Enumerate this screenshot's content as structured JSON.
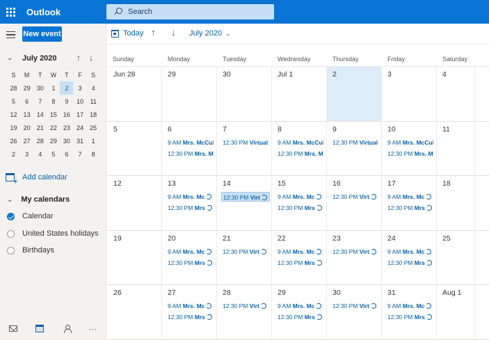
{
  "app": {
    "title": "Outlook"
  },
  "search": {
    "placeholder": "Search"
  },
  "leftpane": {
    "new_event_label": "New event",
    "mini_month_title": "July 2020",
    "dow": [
      "S",
      "M",
      "T",
      "W",
      "T",
      "F",
      "S"
    ],
    "mini_days": [
      "28",
      "29",
      "30",
      "1",
      "2",
      "3",
      "4",
      "5",
      "6",
      "7",
      "8",
      "9",
      "10",
      "11",
      "12",
      "13",
      "14",
      "15",
      "16",
      "17",
      "18",
      "19",
      "20",
      "21",
      "22",
      "23",
      "24",
      "25",
      "26",
      "27",
      "28",
      "29",
      "30",
      "31",
      "1",
      "2",
      "3",
      "4",
      "5",
      "6",
      "7",
      "8"
    ],
    "mini_selected_index": 4,
    "add_calendar_label": "Add calendar",
    "my_calendars_label": "My calendars",
    "calendars": [
      {
        "label": "Calendar",
        "checked": true
      },
      {
        "label": "United States holidays",
        "checked": false
      },
      {
        "label": "Birthdays",
        "checked": false
      }
    ],
    "bottom_icons": [
      "mail-icon",
      "calendar-icon",
      "people-icon",
      "more-icon"
    ]
  },
  "commandbar": {
    "today_label": "Today",
    "month_label": "July 2020"
  },
  "month_view": {
    "weekday_headers": [
      "Sunday",
      "Monday",
      "Tuesday",
      "Wednesday",
      "Thursday",
      "Friday",
      "Saturday"
    ],
    "weeks": [
      [
        {
          "label": "Jun 28",
          "events": []
        },
        {
          "label": "29",
          "events": []
        },
        {
          "label": "30",
          "events": []
        },
        {
          "label": "Jul 1",
          "events": []
        },
        {
          "label": "2",
          "today": true,
          "events": []
        },
        {
          "label": "3",
          "events": []
        },
        {
          "label": "4",
          "events": []
        }
      ],
      [
        {
          "label": "5",
          "events": []
        },
        {
          "label": "6",
          "events": [
            {
              "time": "9 AM",
              "title": "Mrs. McCul",
              "recurring": false
            },
            {
              "time": "12:30 PM",
              "title": "Mrs. Mc",
              "recurring": false
            }
          ]
        },
        {
          "label": "7",
          "events": [
            {
              "time": "12:30 PM",
              "title": "Virtual",
              "recurring": false
            }
          ]
        },
        {
          "label": "8",
          "events": [
            {
              "time": "9 AM",
              "title": "Mrs. McCul",
              "recurring": false
            },
            {
              "time": "12:30 PM",
              "title": "Mrs. Mc",
              "recurring": false
            }
          ]
        },
        {
          "label": "9",
          "events": [
            {
              "time": "12:30 PM",
              "title": "Virtual",
              "recurring": false
            }
          ]
        },
        {
          "label": "10",
          "events": [
            {
              "time": "9 AM",
              "title": "Mrs. McCul",
              "recurring": false
            },
            {
              "time": "12:30 PM",
              "title": "Mrs. Mc",
              "recurring": false
            }
          ]
        },
        {
          "label": "11",
          "events": []
        }
      ],
      [
        {
          "label": "12",
          "events": []
        },
        {
          "label": "13",
          "events": [
            {
              "time": "9 AM",
              "title": "Mrs. Mc",
              "recurring": true
            },
            {
              "time": "12:30 PM",
              "title": "Mrs",
              "recurring": true
            }
          ]
        },
        {
          "label": "14",
          "events": [
            {
              "time": "12:30 PM",
              "title": "Virt",
              "recurring": true,
              "selected": true
            }
          ]
        },
        {
          "label": "15",
          "events": [
            {
              "time": "9 AM",
              "title": "Mrs. Mc",
              "recurring": true
            },
            {
              "time": "12:30 PM",
              "title": "Mrs",
              "recurring": true
            }
          ]
        },
        {
          "label": "16",
          "events": [
            {
              "time": "12:30 PM",
              "title": "Virt",
              "recurring": true
            }
          ]
        },
        {
          "label": "17",
          "events": [
            {
              "time": "9 AM",
              "title": "Mrs. Mc",
              "recurring": true
            },
            {
              "time": "12:30 PM",
              "title": "Mrs",
              "recurring": true
            }
          ]
        },
        {
          "label": "18",
          "events": []
        }
      ],
      [
        {
          "label": "19",
          "events": []
        },
        {
          "label": "20",
          "events": [
            {
              "time": "9 AM",
              "title": "Mrs. Mc",
              "recurring": true
            },
            {
              "time": "12:30 PM",
              "title": "Mrs",
              "recurring": true
            }
          ]
        },
        {
          "label": "21",
          "events": [
            {
              "time": "12:30 PM",
              "title": "Virt",
              "recurring": true
            }
          ]
        },
        {
          "label": "22",
          "events": [
            {
              "time": "9 AM",
              "title": "Mrs. Mc",
              "recurring": true
            },
            {
              "time": "12:30 PM",
              "title": "Mrs",
              "recurring": true
            }
          ]
        },
        {
          "label": "23",
          "events": [
            {
              "time": "12:30 PM",
              "title": "Virt",
              "recurring": true
            }
          ]
        },
        {
          "label": "24",
          "events": [
            {
              "time": "9 AM",
              "title": "Mrs. Mc",
              "recurring": true
            },
            {
              "time": "12:30 PM",
              "title": "Mrs",
              "recurring": true
            }
          ]
        },
        {
          "label": "25",
          "events": []
        }
      ],
      [
        {
          "label": "26",
          "events": []
        },
        {
          "label": "27",
          "events": [
            {
              "time": "9 AM",
              "title": "Mrs. Mc",
              "recurring": true
            },
            {
              "time": "12:30 PM",
              "title": "Mrs",
              "recurring": true
            }
          ]
        },
        {
          "label": "28",
          "events": [
            {
              "time": "12:30 PM",
              "title": "Virt",
              "recurring": true
            }
          ]
        },
        {
          "label": "29",
          "events": [
            {
              "time": "9 AM",
              "title": "Mrs. Mc",
              "recurring": true
            },
            {
              "time": "12:30 PM",
              "title": "Mrs",
              "recurring": true
            }
          ]
        },
        {
          "label": "30",
          "events": [
            {
              "time": "12:30 PM",
              "title": "Virt",
              "recurring": true
            }
          ]
        },
        {
          "label": "31",
          "events": [
            {
              "time": "9 AM",
              "title": "Mrs. Mc",
              "recurring": true
            },
            {
              "time": "12:30 PM",
              "title": "Mrs",
              "recurring": true
            }
          ]
        },
        {
          "label": "Aug 1",
          "events": []
        }
      ]
    ]
  },
  "colors": {
    "brand": "#0a74d4",
    "today_bg": "#deecf9",
    "event_text": "#0a5fa8"
  }
}
